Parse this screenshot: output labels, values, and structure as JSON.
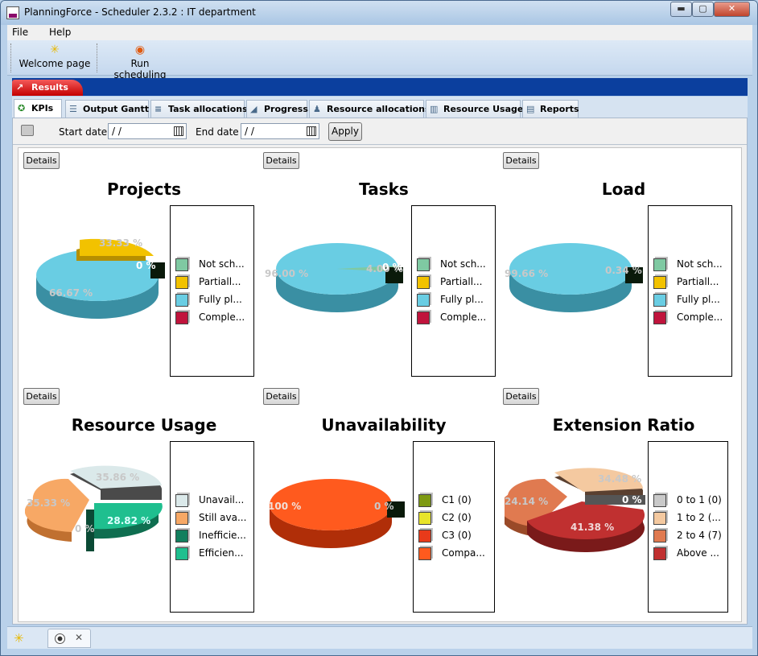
{
  "window": {
    "title": "PlanningForce - Scheduler 2.3.2 : IT department",
    "min": "▬",
    "max": "▢",
    "close": "✕"
  },
  "menu": [
    "File",
    "Help"
  ],
  "toolbar": {
    "welcome": "Welcome page",
    "run": "Run scheduling"
  },
  "results_tab": "Results",
  "tabs": [
    "KPIs",
    "Output Gantt",
    "Task allocations",
    "Progress",
    "Resource allocations",
    "Resource Usage",
    "Reports"
  ],
  "datebar": {
    "start_label": "Start date",
    "start_value": " / /",
    "end_label": "End date",
    "end_value": " / /",
    "apply": "Apply"
  },
  "details_label": "Details",
  "kpis": [
    {
      "title": "Projects",
      "legend": [
        "Not sch...",
        "Partiall...",
        "Fully pl...",
        "Comple..."
      ],
      "legend_colors": [
        "#7fc9a2",
        "#f2c200",
        "#69cde3",
        "#c0143c"
      ],
      "labels": [
        "33.33 %",
        "0 %",
        "66.67 %"
      ]
    },
    {
      "title": "Tasks",
      "legend": [
        "Not sch...",
        "Partiall...",
        "Fully pl...",
        "Comple..."
      ],
      "legend_colors": [
        "#7fc9a2",
        "#f2c200",
        "#69cde3",
        "#c0143c"
      ],
      "labels": [
        "96.00 %",
        "4.00 %",
        "0 %"
      ]
    },
    {
      "title": "Load",
      "legend": [
        "Not sch...",
        "Partiall...",
        "Fully pl...",
        "Comple..."
      ],
      "legend_colors": [
        "#7fc9a2",
        "#f2c200",
        "#69cde3",
        "#c0143c"
      ],
      "labels": [
        "99.66 %",
        "0.34 %"
      ]
    },
    {
      "title": "Resource Usage",
      "legend": [
        "Unavail...",
        "Still ava...",
        "Inefficie...",
        "Efficien..."
      ],
      "legend_colors": [
        "#dbe9ea",
        "#f7a865",
        "#127f5e",
        "#1fbf8f"
      ],
      "labels": [
        "35.86 %",
        "35.33 %",
        "0 %",
        "28.82 %"
      ]
    },
    {
      "title": "Unavailability",
      "legend": [
        "C1 (0)",
        "C2 (0)",
        "C3 (0)",
        "Compa..."
      ],
      "legend_colors": [
        "#7e9a12",
        "#e8e42a",
        "#e83a1a",
        "#ff5a1e"
      ],
      "labels": [
        "100 %",
        "0 %"
      ]
    },
    {
      "title": "Extension Ratio",
      "legend": [
        "0 to 1 (0)",
        "1 to 2 (...",
        "2 to 4 (7)",
        "Above ..."
      ],
      "legend_colors": [
        "#c9c9c9",
        "#f4c9a0",
        "#e07a50",
        "#c03030"
      ],
      "labels": [
        "34.48 %",
        "24.14 %",
        "0 %",
        "41.38 %"
      ]
    }
  ]
}
